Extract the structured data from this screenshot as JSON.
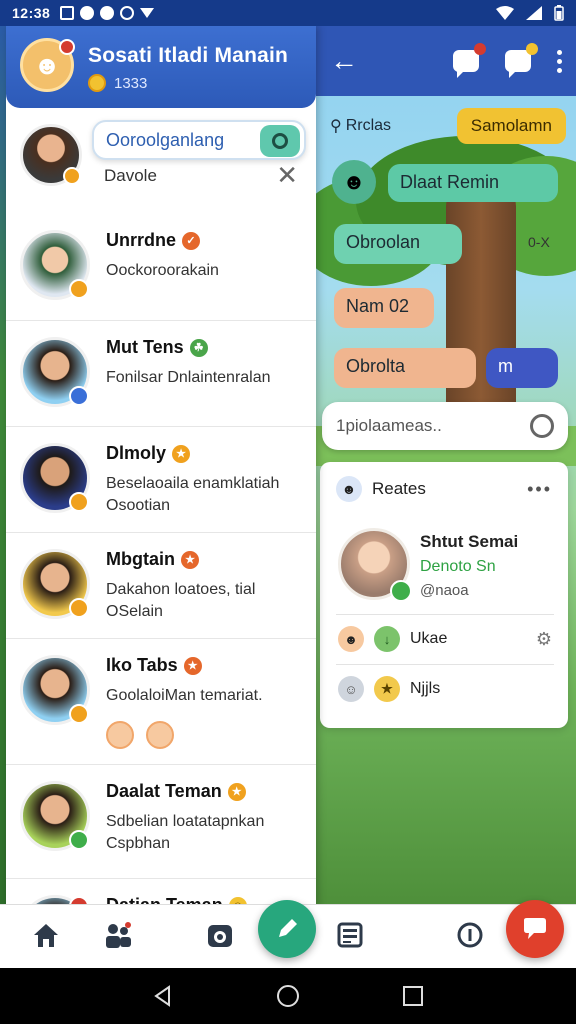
{
  "status_bar": {
    "time": "12:38"
  },
  "left_panel": {
    "header": {
      "title": "Sosati Itladi Manain",
      "coins": "1333"
    },
    "search": {
      "value": "Ooroolganlang",
      "device_label": "Davole"
    },
    "contacts": [
      {
        "name": "Unrrdne",
        "message": "Oockoroorakain",
        "avatar_color": "#dfe7f1",
        "badge_color": "#f0a11e",
        "tag": "✓"
      },
      {
        "name": "Mut Tens",
        "message": "Fonilsar Dnlaintenralan",
        "avatar_color": "#8fd0f2",
        "badge_color": "#3a6fd8",
        "tag": "☺"
      },
      {
        "name": "Dlmoly",
        "message": "Beselaoaila enamklatiah Osootian",
        "avatar_color": "#2b3d8a",
        "badge_color": "#f0a11e",
        "tag": "•"
      },
      {
        "name": "Mbgtain",
        "message": "Dakahon loatoes, tial OSelain",
        "avatar_color": "#f2c94c",
        "badge_color": "#f0a11e",
        "tag": "•"
      },
      {
        "name": "Iko Tabs",
        "message": "GoolaloiMan temariat.",
        "avatar_color": "#8fd0f2",
        "badge_color": "#f0a11e",
        "tag": "•"
      },
      {
        "name": "Daalat Teman",
        "message": "Sdbelian loatatapnkan Cspbhan",
        "avatar_color": "#a8d25a",
        "badge_color": "#3fae4a",
        "tag": "•"
      },
      {
        "name": "Datian Teman",
        "message": "",
        "avatar_color": "#8fd0f2",
        "badge_color": "#d43b2f",
        "tag": "•"
      }
    ]
  },
  "right_panel": {
    "tag_left": "Rrclas",
    "tag_right": "Samolamn",
    "messages": [
      "Dlaat Remin",
      "Obroolan",
      "Nam 02",
      "Obrolta",
      "m"
    ],
    "side_mark": "0-X",
    "search_placeholder": "1piolaameas..",
    "card": {
      "title": "Reates",
      "name": "Shtut Semai",
      "status": "Denoto Sn",
      "sub": "@naoa",
      "row1": "Ukae",
      "row2": "Njjls"
    }
  },
  "colors": {
    "header_blue": "#2d5ab8",
    "accent_green": "#27a77d",
    "accent_red": "#e0402c",
    "tag_yellow": "#f1c232"
  }
}
